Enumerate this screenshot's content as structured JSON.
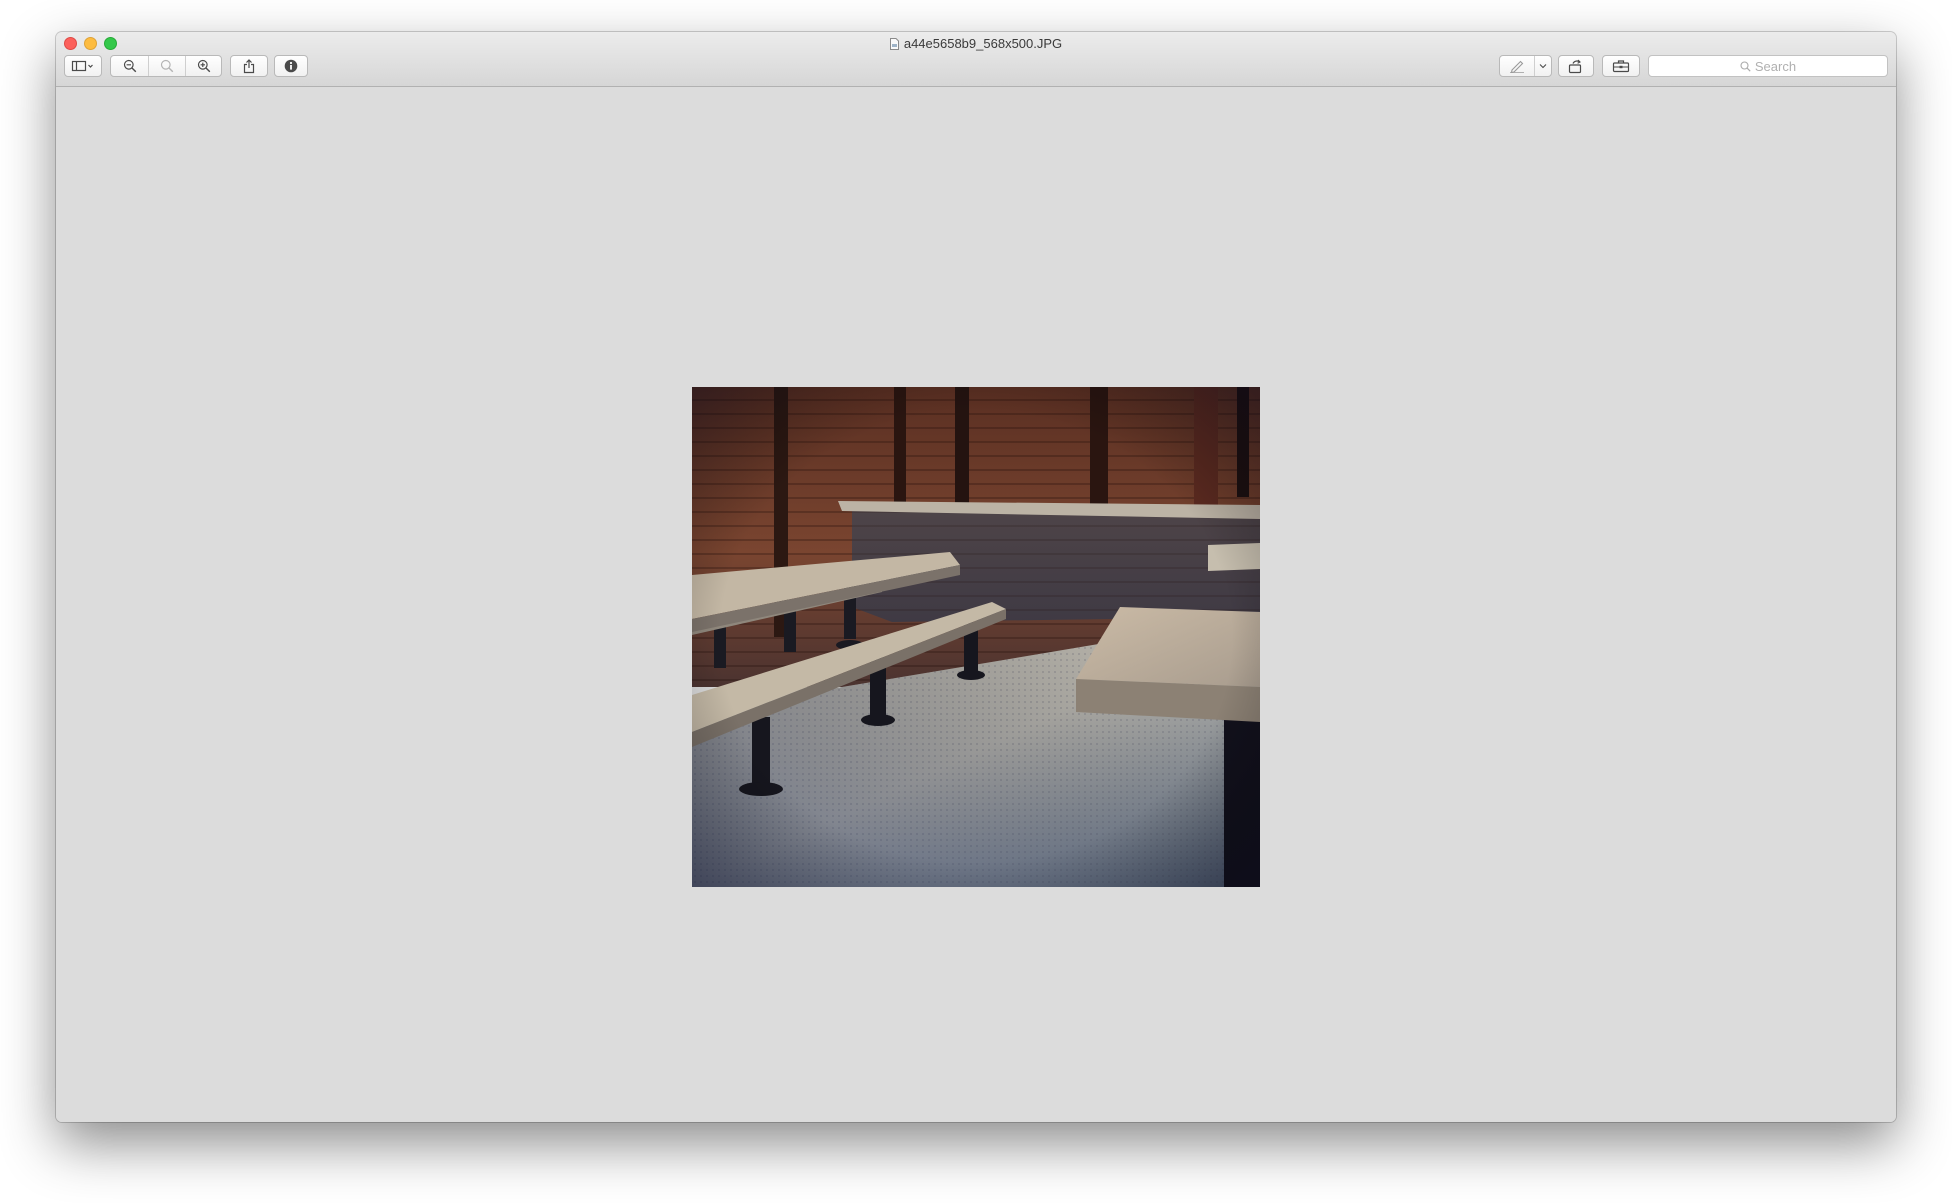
{
  "window": {
    "title": "a44e5658b9_568x500.JPG"
  },
  "toolbar": {
    "sidebar_icon": "sidebar-icon",
    "zoom_out_icon": "zoom-out-icon",
    "zoom_actual_icon": "zoom-actual-icon",
    "zoom_in_icon": "zoom-in-icon",
    "share_icon": "share-icon",
    "info_icon": "info-icon",
    "markup_icon": "pen-icon",
    "rotate_icon": "rotate-icon",
    "toolbox_icon": "toolbox-icon"
  },
  "search": {
    "placeholder": "Search"
  },
  "colors": {
    "close": "#fc605b",
    "minimize": "#fdbc40",
    "zoom": "#34c84a",
    "canvas": "#dcdcdc"
  }
}
